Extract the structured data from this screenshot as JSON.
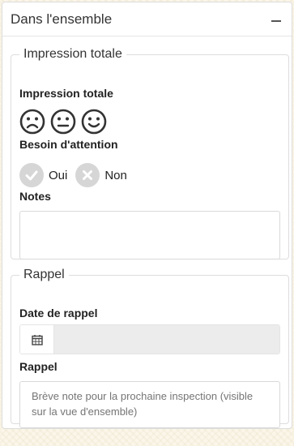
{
  "panel": {
    "title": "Dans l'ensemble",
    "collapse_icon": "minus-icon"
  },
  "impression": {
    "legend": "Impression totale",
    "rating_label": "Impression totale",
    "faces": [
      "sad-face-icon",
      "neutral-face-icon",
      "happy-face-icon"
    ],
    "attention_label": "Besoin d'attention",
    "options": [
      {
        "label": "Oui",
        "icon": "check-icon"
      },
      {
        "label": "Non",
        "icon": "x-icon"
      }
    ],
    "notes_label": "Notes",
    "notes_value": "",
    "notes_placeholder": ""
  },
  "rappel": {
    "legend": "Rappel",
    "date_label": "Date de rappel",
    "date_icon": "calendar-icon",
    "date_value": "",
    "reminder_label": "Rappel",
    "reminder_placeholder": "Brève note pour la prochaine inspection (visible sur la vue d'ensemble)"
  },
  "colors": {
    "radio_bg": "#d6d6d6",
    "date_input_bg": "#ececec",
    "border": "#dddddd"
  }
}
